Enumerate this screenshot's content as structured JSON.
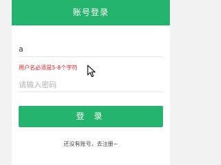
{
  "header": {
    "title": "账号登录"
  },
  "form": {
    "username_value": "a",
    "username_error": "用户名必须是5-8个字符",
    "password_placeholder": "请输入密码",
    "login_label": "登 录",
    "register_link": "还没有账号，去注册~"
  },
  "colors": {
    "accent": "#24b46e",
    "error": "#e02020"
  },
  "icons": {
    "pointer": "mouse-cursor-icon"
  }
}
